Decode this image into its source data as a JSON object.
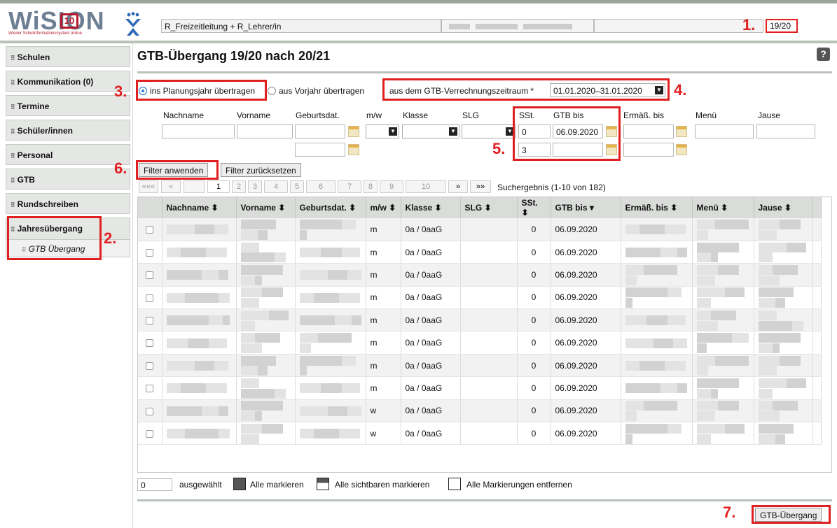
{
  "header": {
    "role": "R_Freizeitleitung + R_Lehrer/in",
    "school_year": "19/20",
    "logo_text": "WiSION",
    "logo_badge": "10",
    "logo_sub": "Wiener Schulinformationssystem online"
  },
  "sidebar": {
    "items": [
      {
        "label": "Schulen"
      },
      {
        "label": "Kommunikation (0)"
      },
      {
        "label": "Termine"
      },
      {
        "label": "Schüler/innen"
      },
      {
        "label": "Personal"
      },
      {
        "label": "GTB"
      },
      {
        "label": "Rundschreiben"
      },
      {
        "label": "Jahresübergang"
      }
    ],
    "sub_item": "GTB Übergang"
  },
  "page": {
    "title": "GTB-Übergang 19/20 nach 20/21",
    "help": "?"
  },
  "options": {
    "radio_planning": "ins Planungsjahr übertragen",
    "radio_prev": "aus Vorjahr übertragen",
    "period_label": "aus dem GTB-Verrechnungszeitraum *",
    "period_value": "01.01.2020–31.01.2020"
  },
  "filters": {
    "headers": [
      "Nachname",
      "Vorname",
      "Geburtsdat.",
      "m/w",
      "Klasse",
      "SLG",
      "SSt.",
      "GTB bis",
      "Ermäß. bis",
      "Menü",
      "Jause"
    ],
    "sst_from": "0",
    "sst_to": "3",
    "gtb_bis": "06.09.2020",
    "apply_label": "Filter anwenden",
    "reset_label": "Filter zurücksetzen"
  },
  "pager": {
    "first": "«««",
    "prev": "«",
    "pages": [
      "1",
      "2",
      "3",
      "4",
      "5",
      "6",
      "7",
      "8",
      "9",
      "10"
    ],
    "next": "»",
    "last": "»»",
    "result": "Suchergebnis (1-10 von 182)"
  },
  "table": {
    "columns": [
      "Nachname ⬍",
      "Vorname ⬍",
      "Geburtsdat. ⬍",
      "m/w ⬍",
      "Klasse ⬍",
      "SLG ⬍",
      "SSt. ⬍",
      "GTB bis ▾",
      "Ermäß. bis ⬍",
      "Menü ⬍",
      "Jause ⬍"
    ],
    "rows": [
      {
        "mw": "m",
        "klasse": "0a / 0aaG",
        "sst": "0",
        "gtb": "06.09.2020"
      },
      {
        "mw": "m",
        "klasse": "0a / 0aaG",
        "sst": "0",
        "gtb": "06.09.2020"
      },
      {
        "mw": "m",
        "klasse": "0a / 0aaG",
        "sst": "0",
        "gtb": "06.09.2020"
      },
      {
        "mw": "m",
        "klasse": "0a / 0aaG",
        "sst": "0",
        "gtb": "06.09.2020"
      },
      {
        "mw": "m",
        "klasse": "0a / 0aaG",
        "sst": "0",
        "gtb": "06.09.2020"
      },
      {
        "mw": "m",
        "klasse": "0a / 0aaG",
        "sst": "0",
        "gtb": "06.09.2020"
      },
      {
        "mw": "m",
        "klasse": "0a / 0aaG",
        "sst": "0",
        "gtb": "06.09.2020"
      },
      {
        "mw": "m",
        "klasse": "0a / 0aaG",
        "sst": "0",
        "gtb": "06.09.2020"
      },
      {
        "mw": "w",
        "klasse": "0a / 0aaG",
        "sst": "0",
        "gtb": "06.09.2020"
      },
      {
        "mw": "w",
        "klasse": "0a / 0aaG",
        "sst": "0",
        "gtb": "06.09.2020"
      }
    ]
  },
  "footer": {
    "selected_count": "0",
    "selected_label": "ausgewählt",
    "mark_all": "Alle markieren",
    "mark_visible": "Alle sichtbaren markieren",
    "remove_marks": "Alle Markierungen entfernen",
    "transition_button": "GTB-Übergang"
  },
  "annotations": [
    "1.",
    "2.",
    "3.",
    "4.",
    "5.",
    "6.",
    "7."
  ],
  "colors": {
    "accent_red": "#e02020",
    "radio_blue": "#2a7bd6"
  }
}
